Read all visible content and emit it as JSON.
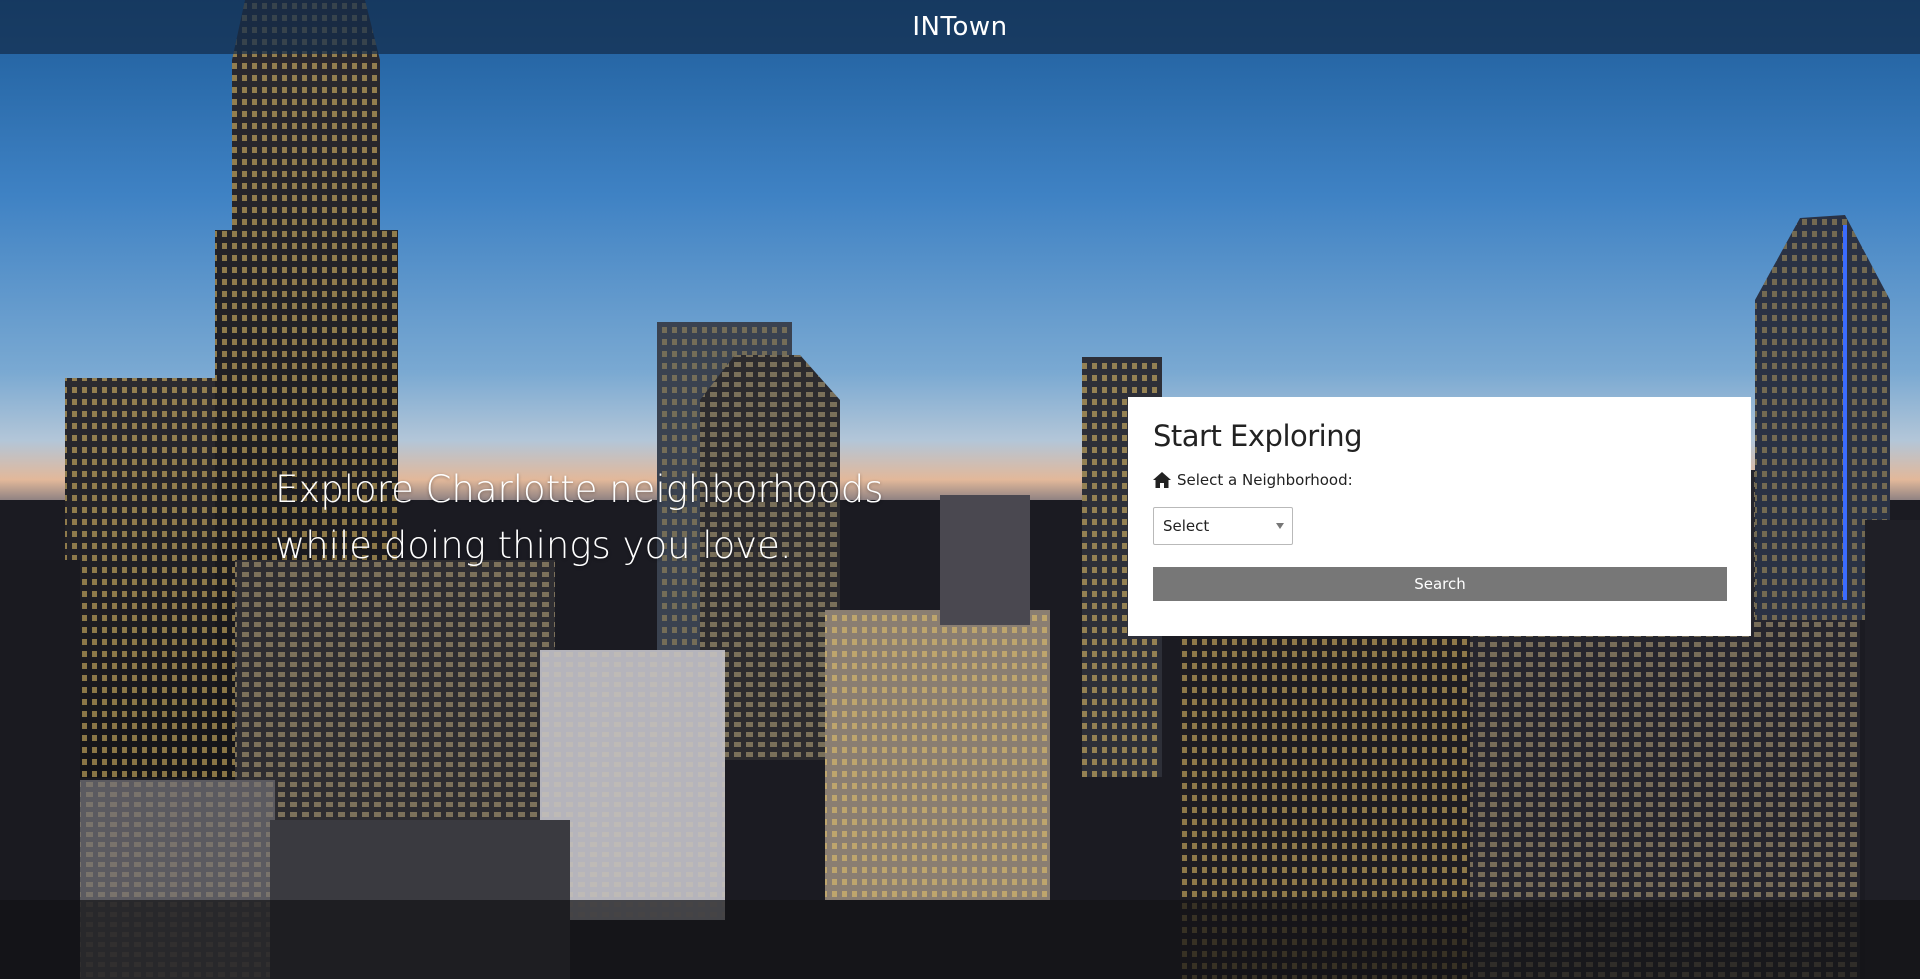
{
  "header": {
    "brand": "INTown"
  },
  "hero": {
    "line1": "Explore Charlotte neighborhoods",
    "line2": "while doing things you love."
  },
  "search_card": {
    "title": "Start Exploring",
    "label": "Select a Neighborhood:",
    "select_value": "Select",
    "button_label": "Search"
  },
  "colors": {
    "button_bg": "#777777",
    "card_bg": "#ffffff",
    "topbar_bg": "#142d4b"
  },
  "icons": {
    "label_icon": "home-icon",
    "select_icon": "chevron-down-icon"
  }
}
